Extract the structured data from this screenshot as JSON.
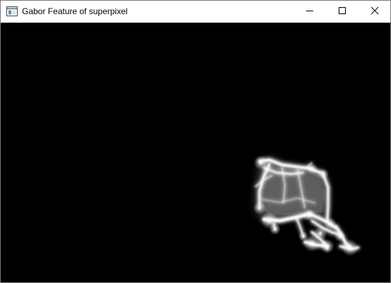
{
  "window": {
    "title": "Gabor Feature of superpixel"
  },
  "titlebar": {
    "icons": {
      "app": "app-window-icon",
      "minimize": "minimize-icon",
      "maximize": "maximize-icon",
      "close": "close-icon"
    }
  },
  "image": {
    "description_kind": "gabor-filter-response",
    "background_color": "#000000",
    "feature_color": "#ffffff"
  }
}
